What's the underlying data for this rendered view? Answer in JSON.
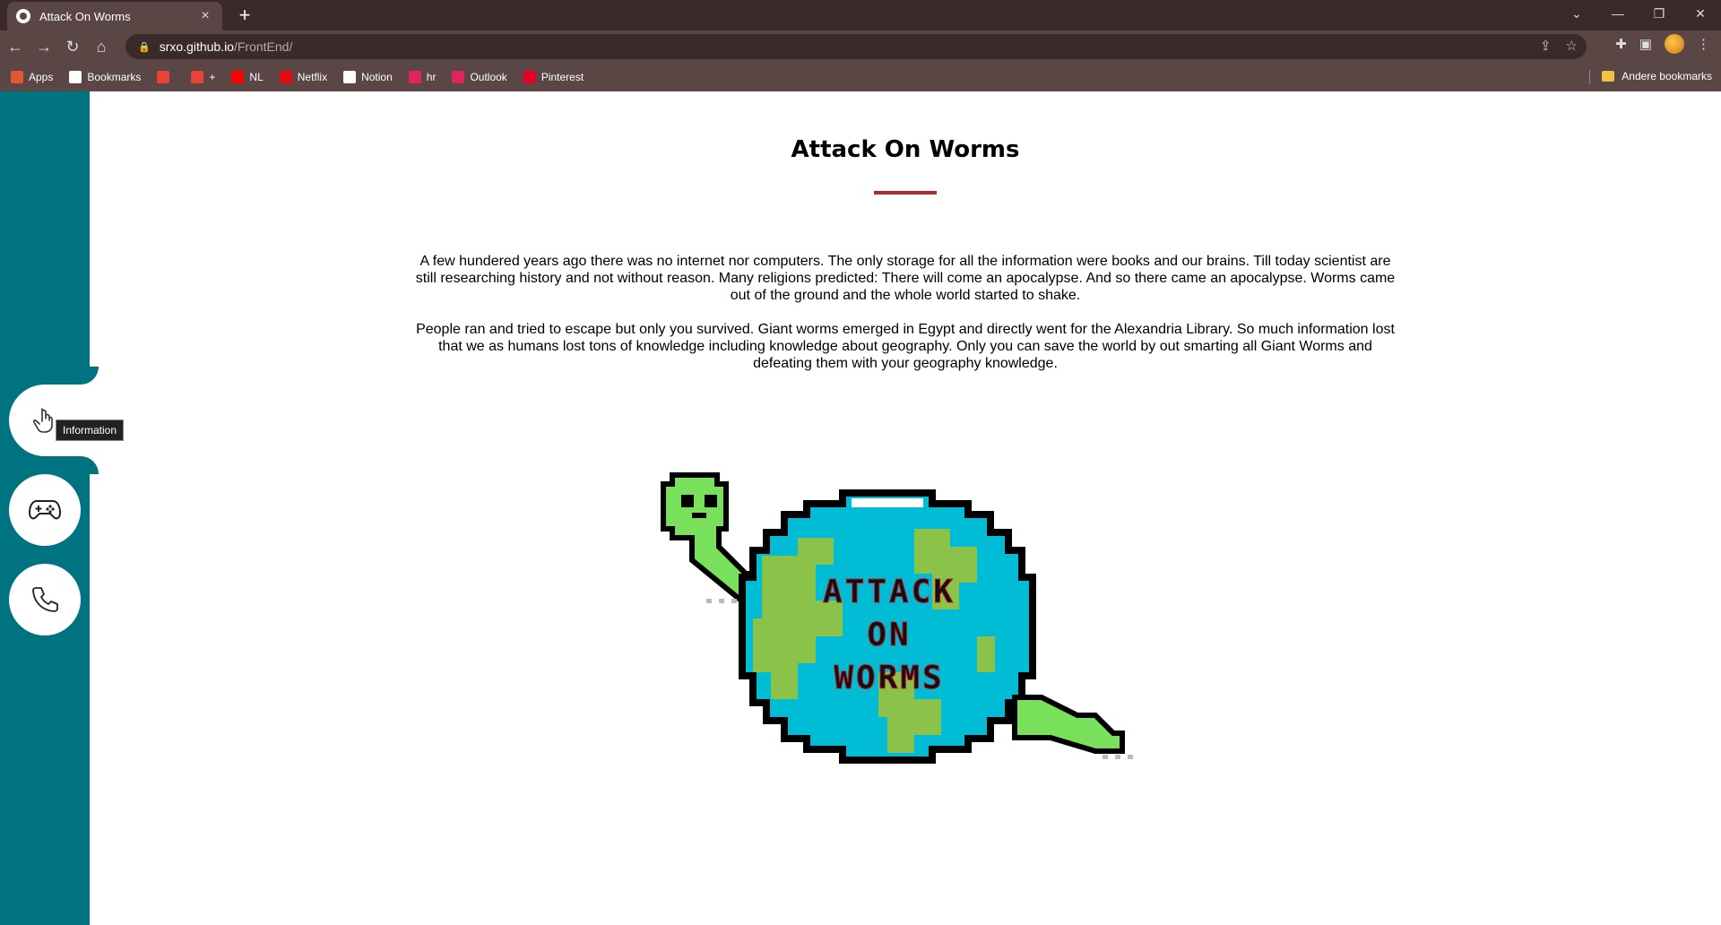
{
  "browser": {
    "tab_title": "Attack On Worms",
    "url_host": "srxo.github.io",
    "url_path": "/FrontEnd/",
    "bookmarks": [
      {
        "label": "Apps",
        "icon": "apps-grid-icon",
        "color": "#e4572e"
      },
      {
        "label": "Bookmarks",
        "icon": "star-icon",
        "color": "#ffffff"
      },
      {
        "label": "",
        "icon": "gmail-icon",
        "color": "#ea4335"
      },
      {
        "label": "+",
        "icon": "gmail-icon",
        "color": "#ea4335"
      },
      {
        "label": "NL",
        "icon": "youtube-icon",
        "color": "#ff0000"
      },
      {
        "label": "Netflix",
        "icon": "netflix-icon",
        "color": "#e50914"
      },
      {
        "label": "Notion",
        "icon": "notion-icon",
        "color": "#ffffff"
      },
      {
        "label": "hr",
        "icon": "hr-icon",
        "color": "#e0245e"
      },
      {
        "label": "Outlook",
        "icon": "outlook-icon",
        "color": "#e0245e"
      },
      {
        "label": "Pinterest",
        "icon": "pinterest-icon",
        "color": "#e60023"
      }
    ],
    "other_bookmarks": "Andere bookmarks"
  },
  "page": {
    "title": "Attack On Worms",
    "accent": "#b02a2a",
    "sidebar_color": "#007380",
    "paragraph1": "A few hundered years ago there was no internet nor computers. The only storage for all the information were books and our brains. Till today scientist are still researching history and not without reason. Many religions predicted: There will come an apocalypse. And so there came an apocalypse. Worms came out of the ground and the whole world started to shake.",
    "paragraph2": "People ran and tried to escape but only you survived. Giant worms emerged in Egypt and directly went for the Alexandria Library. So much information lost that we as humans lost tons of knowledge including knowledge about geography. Only you can save the world by out smarting all Giant Worms and defeating them with your geography knowledge.",
    "logo_text": [
      "ATTACK",
      "ON",
      "WORMS"
    ]
  },
  "sidebar": {
    "tooltip": "Information",
    "items": [
      {
        "icon": "information-icon"
      },
      {
        "icon": "gamepad-icon"
      },
      {
        "icon": "phone-icon"
      }
    ]
  }
}
